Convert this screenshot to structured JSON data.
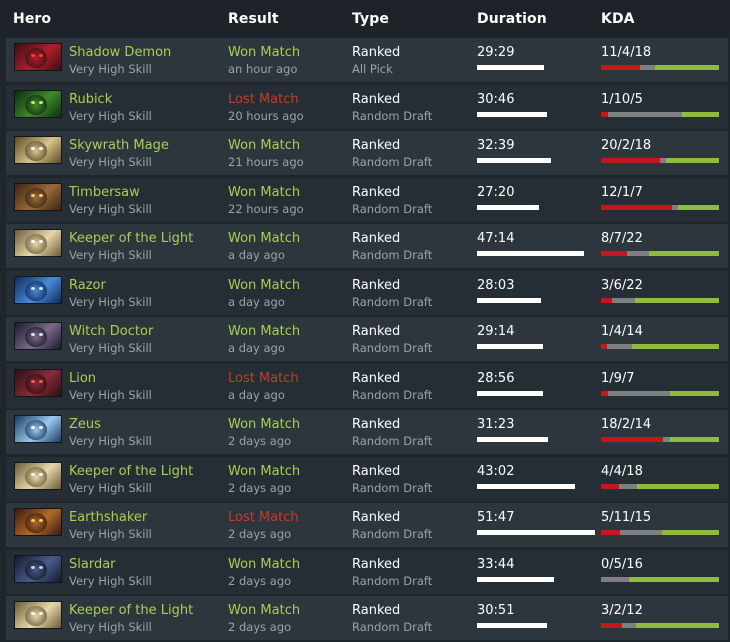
{
  "headers": {
    "hero": "Hero",
    "result": "Result",
    "type": "Type",
    "duration": "Duration",
    "kda": "KDA"
  },
  "colors": {
    "won": "#a9cf54",
    "lost": "#c23c2a",
    "kills_bar": "#c4171b",
    "deaths_bar": "#7d7f80",
    "assists_bar": "#8fbc3c"
  },
  "matches": [
    {
      "hero": "Shadow Demon",
      "portrait": "shadow-demon-portrait",
      "skill": "Very High Skill",
      "result": "Won Match",
      "outcome": "won",
      "time": "an hour ago",
      "type": "Ranked",
      "mode": "All Pick",
      "duration": "29:29",
      "kda": "11/4/18",
      "kills": 11,
      "deaths": 4,
      "assists": 18
    },
    {
      "hero": "Rubick",
      "portrait": "rubick-portrait",
      "skill": "Very High Skill",
      "result": "Lost Match",
      "outcome": "lost",
      "time": "20 hours ago",
      "type": "Ranked",
      "mode": "Random Draft",
      "duration": "30:46",
      "kda": "1/10/5",
      "kills": 1,
      "deaths": 10,
      "assists": 5
    },
    {
      "hero": "Skywrath Mage",
      "portrait": "skywrath-mage-portrait",
      "skill": "Very High Skill",
      "result": "Won Match",
      "outcome": "won",
      "time": "21 hours ago",
      "type": "Ranked",
      "mode": "Random Draft",
      "duration": "32:39",
      "kda": "20/2/18",
      "kills": 20,
      "deaths": 2,
      "assists": 18
    },
    {
      "hero": "Timbersaw",
      "portrait": "timbersaw-portrait",
      "skill": "Very High Skill",
      "result": "Won Match",
      "outcome": "won",
      "time": "22 hours ago",
      "type": "Ranked",
      "mode": "Random Draft",
      "duration": "27:20",
      "kda": "12/1/7",
      "kills": 12,
      "deaths": 1,
      "assists": 7
    },
    {
      "hero": "Keeper of the Light",
      "portrait": "keeper-of-the-light-portrait",
      "skill": "Very High Skill",
      "result": "Won Match",
      "outcome": "won",
      "time": "a day ago",
      "type": "Ranked",
      "mode": "Random Draft",
      "duration": "47:14",
      "kda": "8/7/22",
      "kills": 8,
      "deaths": 7,
      "assists": 22
    },
    {
      "hero": "Razor",
      "portrait": "razor-portrait",
      "skill": "Very High Skill",
      "result": "Won Match",
      "outcome": "won",
      "time": "a day ago",
      "type": "Ranked",
      "mode": "Random Draft",
      "duration": "28:03",
      "kda": "3/6/22",
      "kills": 3,
      "deaths": 6,
      "assists": 22
    },
    {
      "hero": "Witch Doctor",
      "portrait": "witch-doctor-portrait",
      "skill": "Very High Skill",
      "result": "Won Match",
      "outcome": "won",
      "time": "a day ago",
      "type": "Ranked",
      "mode": "Random Draft",
      "duration": "29:14",
      "kda": "1/4/14",
      "kills": 1,
      "deaths": 4,
      "assists": 14
    },
    {
      "hero": "Lion",
      "portrait": "lion-portrait",
      "skill": "Very High Skill",
      "result": "Lost Match",
      "outcome": "lost",
      "time": "a day ago",
      "type": "Ranked",
      "mode": "Random Draft",
      "duration": "28:56",
      "kda": "1/9/7",
      "kills": 1,
      "deaths": 9,
      "assists": 7
    },
    {
      "hero": "Zeus",
      "portrait": "zeus-portrait",
      "skill": "Very High Skill",
      "result": "Won Match",
      "outcome": "won",
      "time": "2 days ago",
      "type": "Ranked",
      "mode": "Random Draft",
      "duration": "31:23",
      "kda": "18/2/14",
      "kills": 18,
      "deaths": 2,
      "assists": 14
    },
    {
      "hero": "Keeper of the Light",
      "portrait": "keeper-of-the-light-portrait",
      "skill": "Very High Skill",
      "result": "Won Match",
      "outcome": "won",
      "time": "2 days ago",
      "type": "Ranked",
      "mode": "Random Draft",
      "duration": "43:02",
      "kda": "4/4/18",
      "kills": 4,
      "deaths": 4,
      "assists": 18
    },
    {
      "hero": "Earthshaker",
      "portrait": "earthshaker-portrait",
      "skill": "Very High Skill",
      "result": "Lost Match",
      "outcome": "lost",
      "time": "2 days ago",
      "type": "Ranked",
      "mode": "Random Draft",
      "duration": "51:47",
      "kda": "5/11/15",
      "kills": 5,
      "deaths": 11,
      "assists": 15
    },
    {
      "hero": "Slardar",
      "portrait": "slardar-portrait",
      "skill": "Very High Skill",
      "result": "Won Match",
      "outcome": "won",
      "time": "2 days ago",
      "type": "Ranked",
      "mode": "Random Draft",
      "duration": "33:44",
      "kda": "0/5/16",
      "kills": 0,
      "deaths": 5,
      "assists": 16
    },
    {
      "hero": "Keeper of the Light",
      "portrait": "keeper-of-the-light-portrait",
      "skill": "Very High Skill",
      "result": "Won Match",
      "outcome": "won",
      "time": "2 days ago",
      "type": "Ranked",
      "mode": "Random Draft",
      "duration": "30:51",
      "kda": "3/2/12",
      "kills": 3,
      "deaths": 2,
      "assists": 12
    }
  ]
}
